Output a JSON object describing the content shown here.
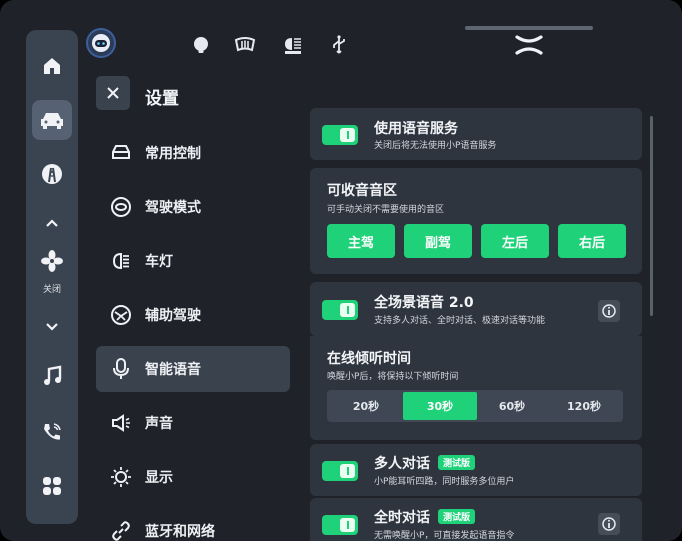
{
  "top_icons": [
    "assistant-avatar-icon",
    "light-icon",
    "rear-defrost-icon",
    "auto-headlight-icon",
    "usb-icon"
  ],
  "colors": {
    "accent": "#1fd27a",
    "background": "#1f2329",
    "card": "#2f353e",
    "dock": "#3a4350"
  },
  "dock": {
    "items": [
      "home-icon",
      "car-icon",
      "road-icon",
      "chevron-up-icon",
      "fan-icon",
      "chevron-down-icon",
      "music-icon",
      "phone-icon",
      "apps-icon"
    ],
    "fan_label": "关闭"
  },
  "settings": {
    "title": "设置",
    "categories": [
      {
        "label": "常用控制",
        "icon": "car-front-icon"
      },
      {
        "label": "驾驶模式",
        "icon": "steering-icon"
      },
      {
        "label": "车灯",
        "icon": "headlight-icon"
      },
      {
        "label": "辅助驾驶",
        "icon": "assist-drive-icon"
      },
      {
        "label": "智能语音",
        "icon": "mic-icon"
      },
      {
        "label": "声音",
        "icon": "speaker-icon"
      },
      {
        "label": "显示",
        "icon": "sun-icon"
      },
      {
        "label": "蓝牙和网络",
        "icon": "link-icon"
      }
    ],
    "active_category": "智能语音"
  },
  "voice": {
    "service": {
      "title": "使用语音服务",
      "desc": "关闭后将无法使用小P语音服务",
      "on": true
    },
    "zones": {
      "title": "可收音音区",
      "desc": "可手动关闭不需要使用的音区",
      "buttons": [
        "主驾",
        "副驾",
        "左后",
        "右后"
      ]
    },
    "fullscene": {
      "title": "全场景语音 2.0",
      "desc": "支持多人对话、全时对话、极速对话等功能",
      "on": true
    },
    "listen": {
      "title": "在线倾听时间",
      "desc": "唤醒小P后，将保持以下倾听时间",
      "options": [
        "20秒",
        "30秒",
        "60秒",
        "120秒"
      ],
      "selected": "30秒"
    },
    "multi": {
      "title": "多人对话",
      "badge": "测试版",
      "desc": "小P能耳听四路，同时服务多位用户",
      "on": true
    },
    "fulltime": {
      "title": "全时对话",
      "badge": "测试版",
      "desc": "无需唤醒小P，可直接发起语音指令",
      "on": true
    }
  }
}
